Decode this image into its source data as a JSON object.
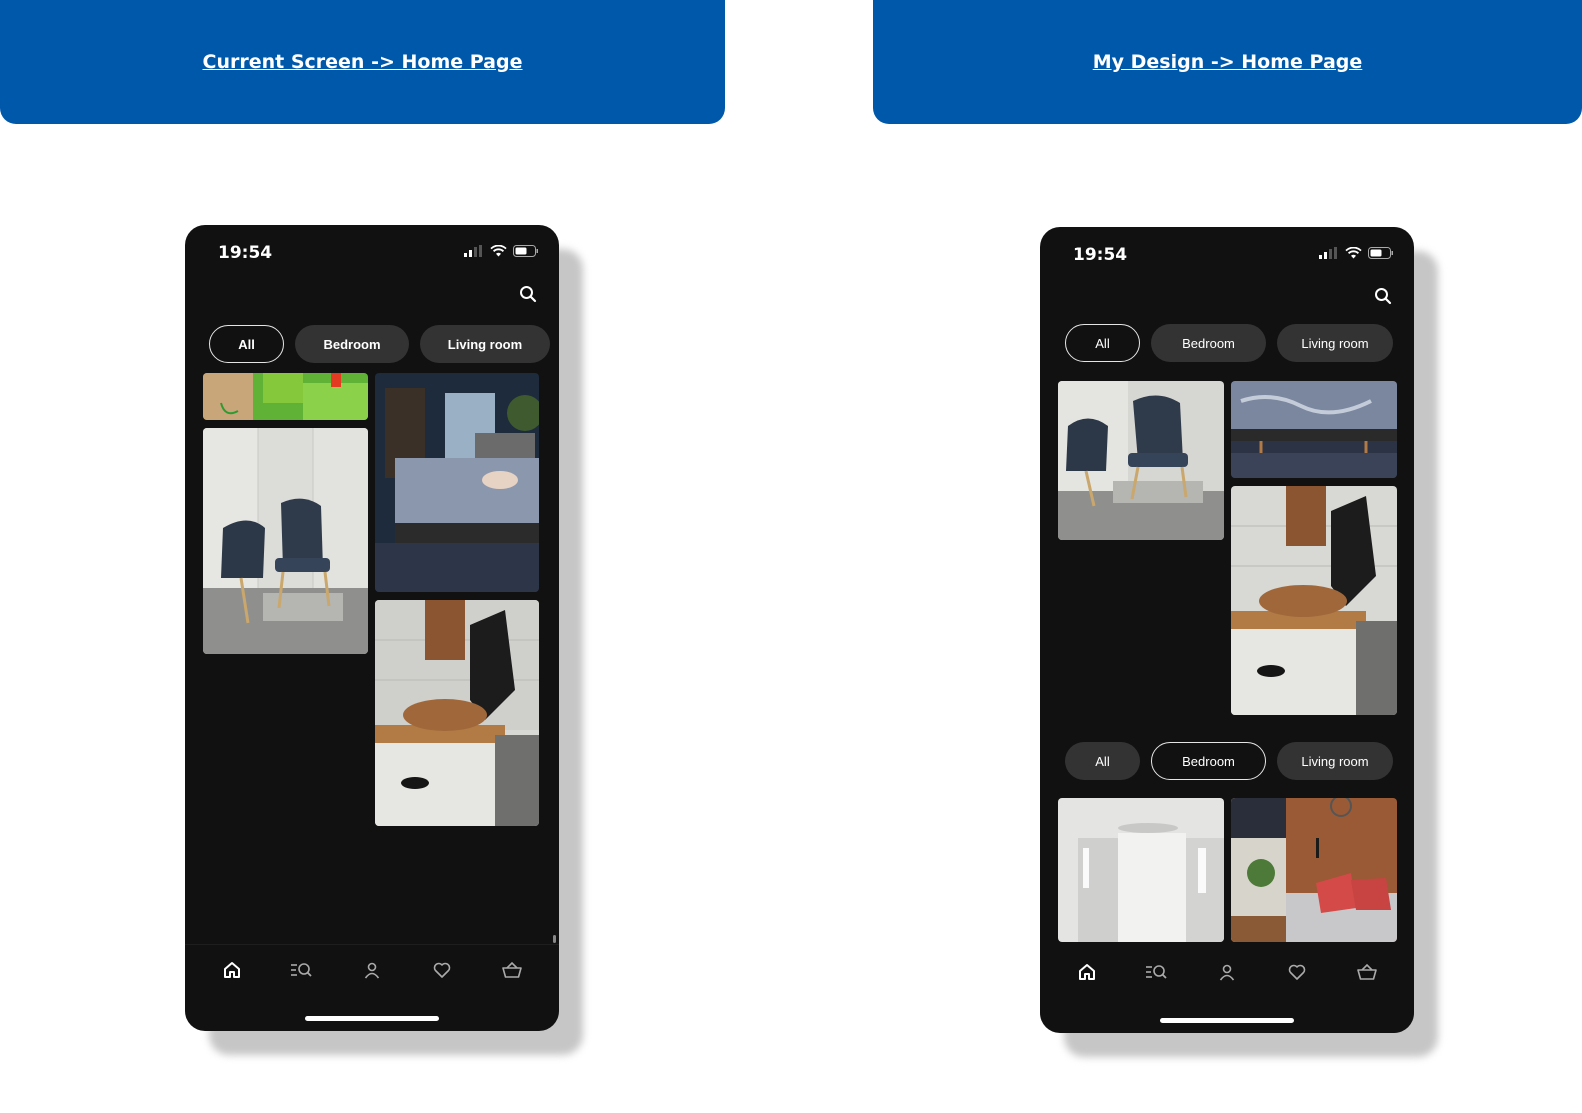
{
  "banners": {
    "left_title": "Current Screen -> Home Page",
    "right_title": "My Design -> Home Page"
  },
  "current_screen": {
    "status_time": "19:54",
    "chips": [
      {
        "label": "All",
        "selected": true
      },
      {
        "label": "Bedroom",
        "selected": false
      },
      {
        "label": "Living room",
        "selected": false
      }
    ],
    "nav": [
      "home-icon",
      "browse-search-icon",
      "profile-icon",
      "heart-icon",
      "basket-icon"
    ]
  },
  "my_design": {
    "status_time": "19:54",
    "chips_top": [
      {
        "label": "All",
        "selected": true
      },
      {
        "label": "Bedroom",
        "selected": false
      },
      {
        "label": "Living room",
        "selected": false
      }
    ],
    "chips_bottom": [
      {
        "label": "All",
        "selected": false
      },
      {
        "label": "Bedroom",
        "selected": true
      },
      {
        "label": "Living room",
        "selected": false
      }
    ],
    "nav": [
      "home-icon",
      "browse-search-icon",
      "profile-icon",
      "heart-icon",
      "basket-icon"
    ]
  },
  "colors": {
    "banner": "#0058ab",
    "phone_bg": "#111111",
    "chip_bg": "#333333",
    "chip_selected_border": "#e5e5e5"
  }
}
